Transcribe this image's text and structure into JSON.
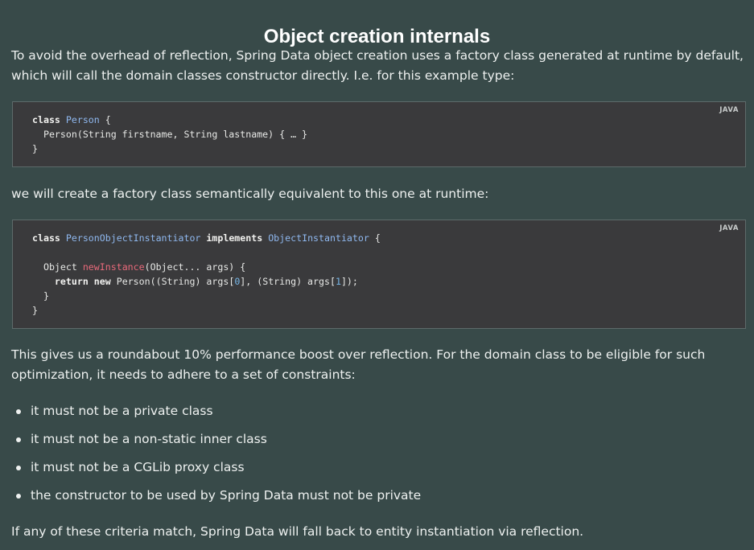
{
  "title": "Object creation internals",
  "paragraphs": {
    "intro": "To avoid the overhead of reflection, Spring Data object creation uses a factory class generated at runtime by default, which will call the domain classes constructor directly. I.e. for this example type:",
    "factory": "we will create a factory class semantically equivalent to this one at runtime:",
    "boost": "This gives us a roundabout 10% performance boost over reflection. For the domain class to be eligible for such optimization, it needs to adhere to a set of constraints:",
    "fallback": "If any of these criteria match, Spring Data will fall back to entity instantiation via reflection."
  },
  "code_blocks": [
    {
      "language": "JAVA",
      "lines": [
        "class Person {",
        "  Person(String firstname, String lastname) { … }",
        "}"
      ]
    },
    {
      "language": "JAVA",
      "lines": [
        "class PersonObjectInstantiator implements ObjectInstantiator {",
        "",
        "  Object newInstance(Object... args) {",
        "    return new Person((String) args[0], (String) args[1]);",
        "  }",
        "}"
      ]
    }
  ],
  "constraints": [
    "it must not be a private class",
    "it must not be a non-static inner class",
    "it must not be a CGLib proxy class",
    "the constructor to be used by Spring Data must not be private"
  ],
  "colors": {
    "background": "#384a49",
    "code_background": "#3a3a3c",
    "type_name": "#8fb8ef",
    "method_name": "#e8697a",
    "number": "#77b7e8"
  }
}
